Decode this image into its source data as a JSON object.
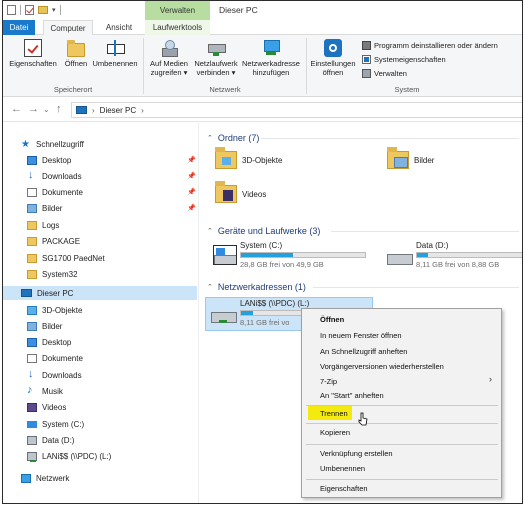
{
  "window": {
    "title": "Dieser PC",
    "context_tab_header": "Verwalten"
  },
  "tabs": [
    {
      "label": "Datei"
    },
    {
      "label": "Computer"
    },
    {
      "label": "Ansicht"
    },
    {
      "label": "Laufwerktools"
    }
  ],
  "ribbon": {
    "speicherort": {
      "label": "Speicherort",
      "eigenschaften": "Eigenschaften",
      "oeffnen": "Öffnen",
      "umbenennen": "Umbenennen"
    },
    "netzwerk": {
      "label": "Netzwerk",
      "medien1": "Auf Medien",
      "medien2": "zugreifen",
      "laufwerk1": "Netzlaufwerk",
      "laufwerk2": "verbinden",
      "adresse1": "Netzwerkadresse",
      "adresse2": "hinzufügen"
    },
    "system": {
      "label": "System",
      "einst1": "Einstellungen",
      "einst2": "öffnen",
      "programm": "Programm deinstallieren oder ändern",
      "eigen": "Systemeigenschaften",
      "verwalten": "Verwalten"
    }
  },
  "address": {
    "crumb": "Dieser PC"
  },
  "nav": {
    "quick": "Schnellzugriff",
    "quick_items": [
      "Desktop",
      "Downloads",
      "Dokumente",
      "Bilder",
      "Logs",
      "PACKAGE",
      "SG1700 PaedNet",
      "System32"
    ],
    "pc": "Dieser PC",
    "pc_items": [
      "3D-Objekte",
      "Bilder",
      "Desktop",
      "Dokumente",
      "Downloads",
      "Musik",
      "Videos",
      "System (C:)",
      "Data (D:)",
      "LANi$$ (\\\\PDC) (L:)"
    ],
    "network": "Netzwerk"
  },
  "content": {
    "ordner": {
      "header": "Ordner (7)",
      "items": [
        "3D-Objekte",
        "Bilder",
        "Videos"
      ]
    },
    "geraete": {
      "header": "Geräte und Laufwerke (3)",
      "drives": [
        {
          "name": "System (C:)",
          "free": "28,8 GB frei von 49,9 GB",
          "used_fraction": 0.42
        },
        {
          "name": "Data (D:)",
          "free": "8,11 GB frei von 8,88 GB",
          "used_fraction": 0.09
        }
      ]
    },
    "netz": {
      "header": "Netzwerkadressen (1)",
      "drive": {
        "name": "LANi$$ (\\\\PDC) (L:)",
        "free": "8,11 GB frei vo",
        "used_fraction": 0.1
      }
    }
  },
  "context_menu": {
    "items": [
      "Öffnen",
      "In neuem Fenster öffnen",
      "An Schnellzugriff anheften",
      "Vorgängerversionen wiederherstellen",
      "7-Zip",
      "An \"Start\" anheften",
      "Trennen",
      "Kopieren",
      "Verknüpfung erstellen",
      "Umbenennen",
      "Eigenschaften"
    ],
    "highlight_color": "#f4ea0d"
  }
}
